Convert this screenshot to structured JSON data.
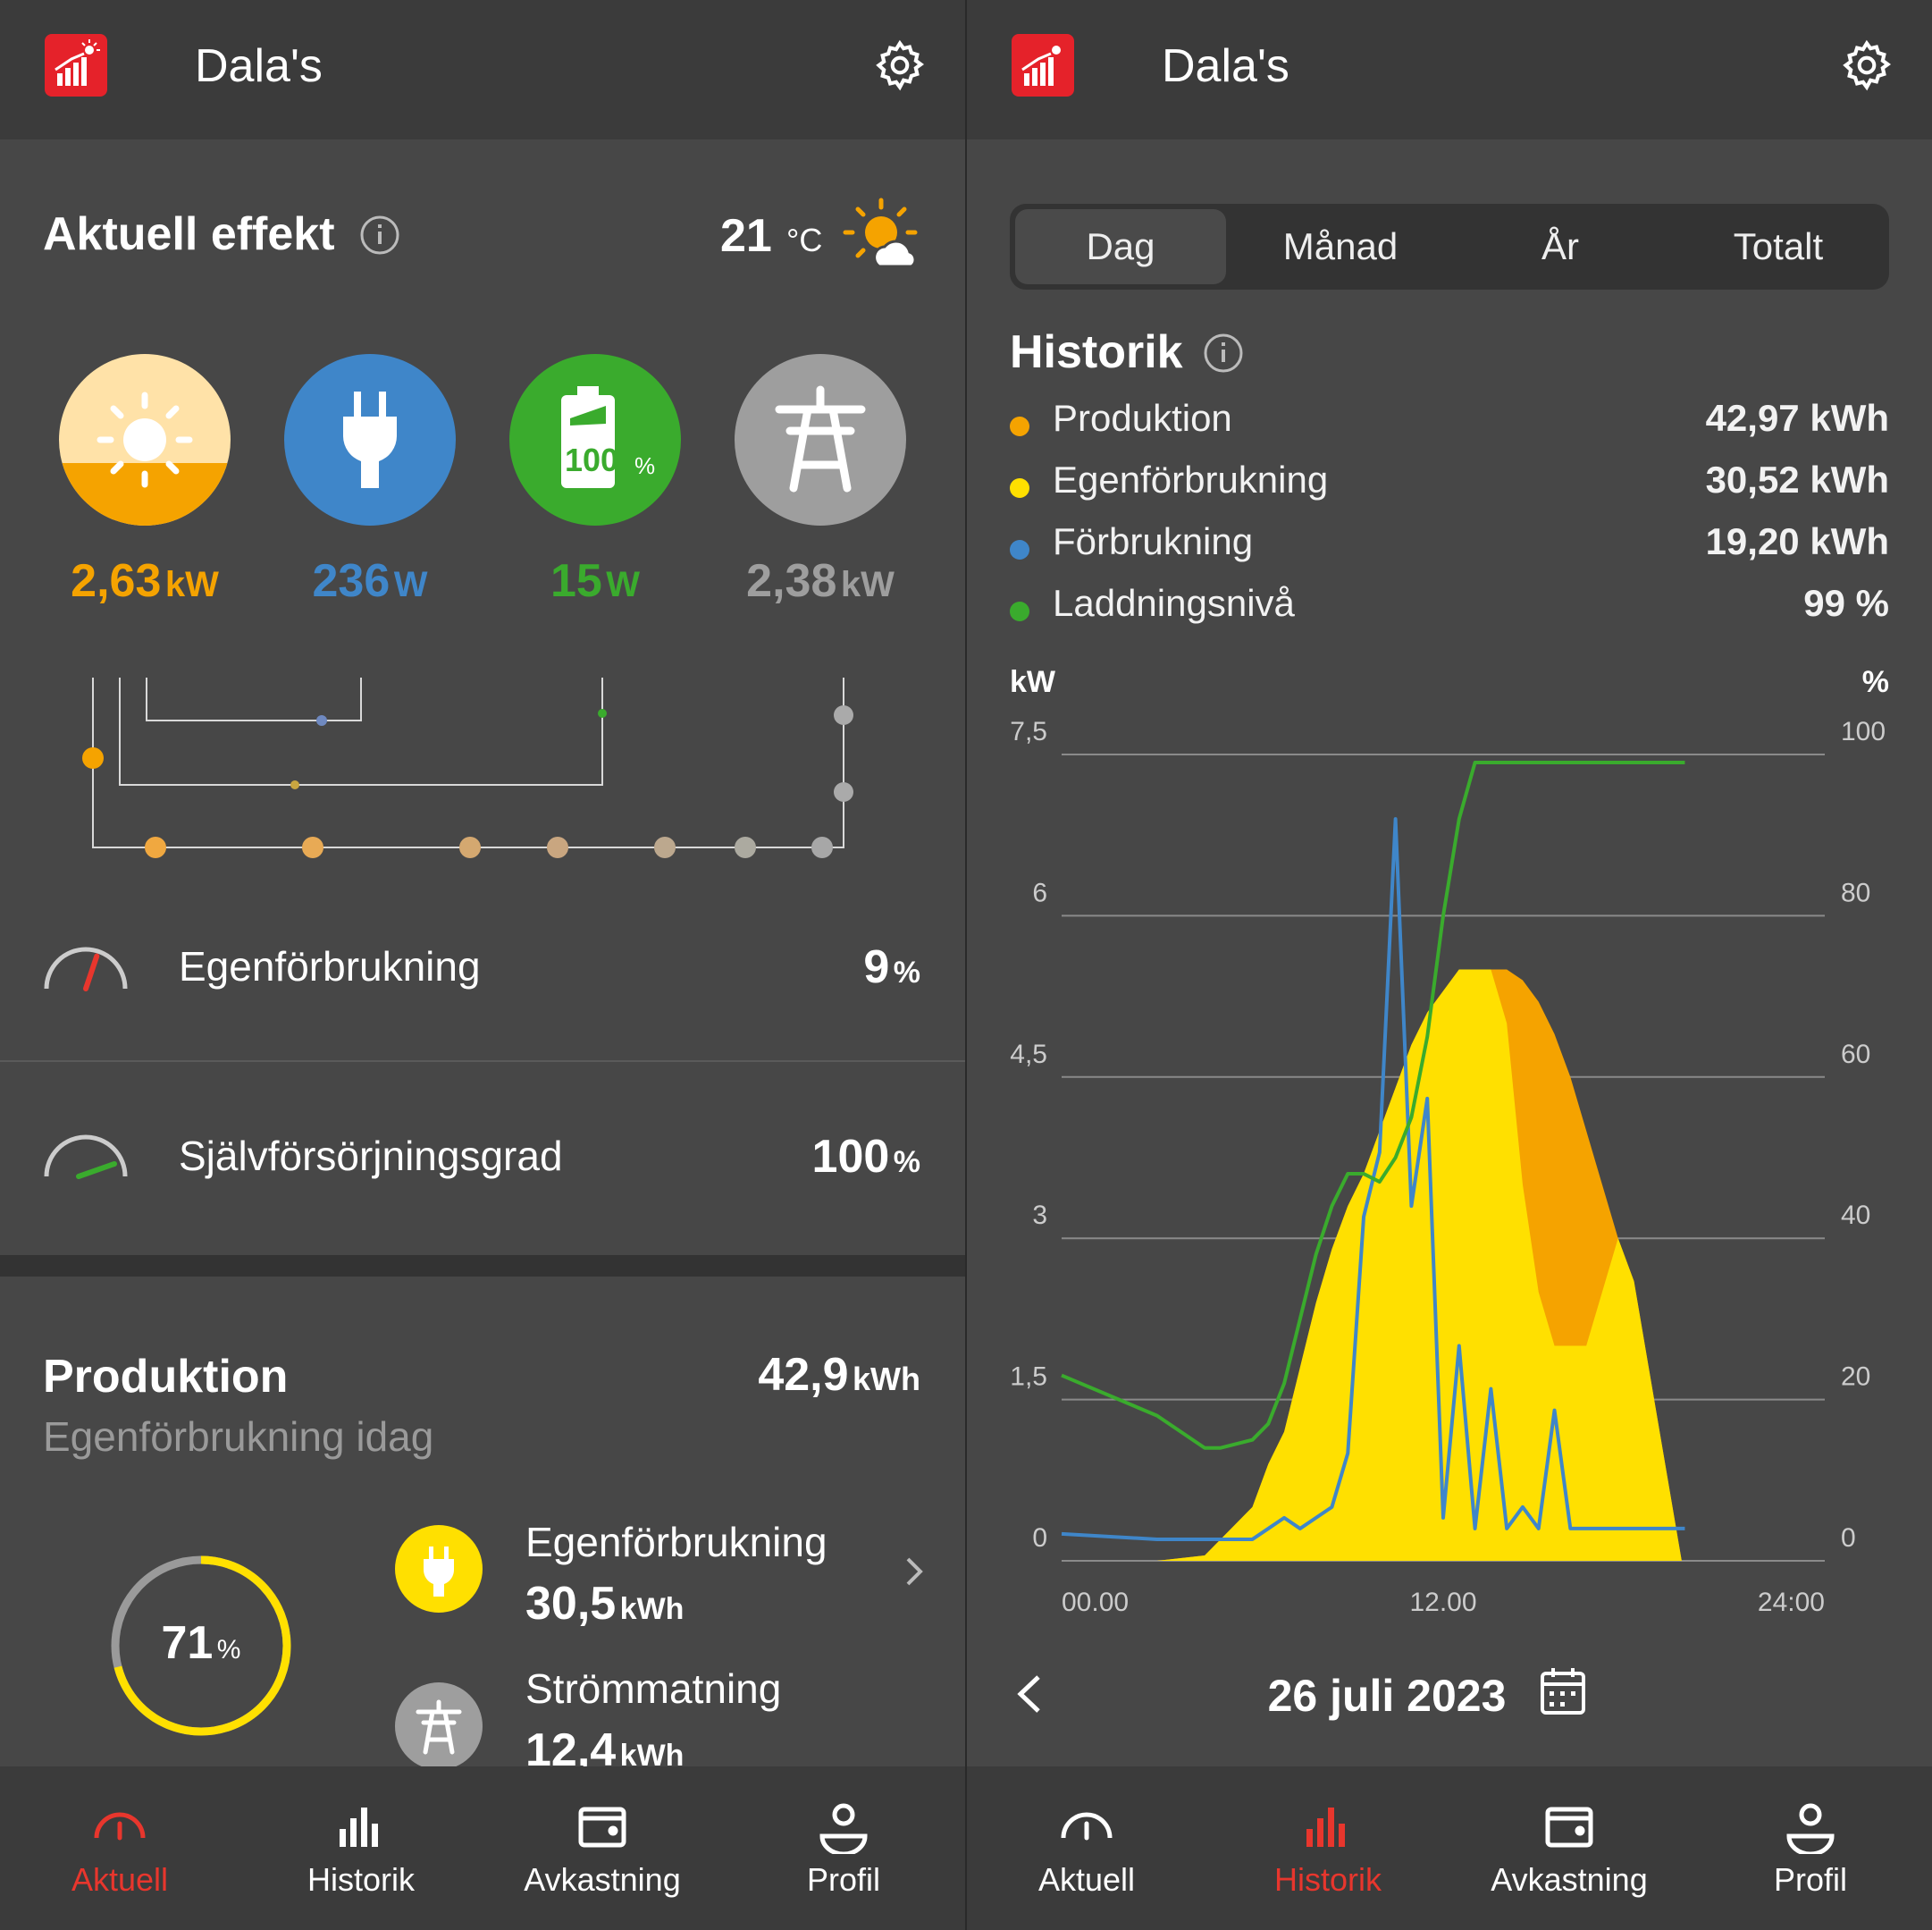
{
  "app_title": "Dala's",
  "left": {
    "section_title": "Aktuell effekt",
    "temperature": {
      "value": "21",
      "unit": "°C"
    },
    "flows": [
      {
        "name": "solar",
        "value": "2,63",
        "unit": "kW",
        "color": "#f5a300"
      },
      {
        "name": "consumption",
        "value": "236",
        "unit": "W",
        "color": "#3f86c9"
      },
      {
        "name": "battery",
        "value": "15",
        "unit": "W",
        "color": "#3aab2d",
        "battery_label": "100",
        "battery_unit": "%"
      },
      {
        "name": "grid",
        "value": "2,38",
        "unit": "kW",
        "color": "#9e9e9e"
      }
    ],
    "metrics": [
      {
        "label": "Egenförbrukning",
        "value": "9",
        "unit": "%"
      },
      {
        "label": "Självförsörjningsgrad",
        "value": "100",
        "unit": "%"
      }
    ],
    "production": {
      "title": "Produktion",
      "value": "42,9",
      "unit": "kWh",
      "subtitle": "Egenförbrukning idag",
      "ring_value": "71",
      "ring_unit": "%",
      "ring_fraction": 0.71,
      "items": [
        {
          "label": "Egenförbrukning",
          "value": "30,5",
          "unit": "kWh"
        },
        {
          "label": "Strömmatning",
          "value": "12,4",
          "unit": "kWh"
        }
      ]
    }
  },
  "right": {
    "tabs": [
      "Dag",
      "Månad",
      "År",
      "Totalt"
    ],
    "selected_tab": "Dag",
    "history_title": "Historik",
    "legend": [
      {
        "label": "Produktion",
        "value": "42,97 kWh",
        "color": "#f5a300"
      },
      {
        "label": "Egenförbrukning",
        "value": "30,52 kWh",
        "color": "#ffe000"
      },
      {
        "label": "Förbrukning",
        "value": "19,20 kWh",
        "color": "#3f86c9"
      },
      {
        "label": "Laddningsnivå",
        "value": "99 %",
        "color": "#3aab2d"
      }
    ],
    "date": "26 juli 2023"
  },
  "chart_data": {
    "type": "area",
    "xlabel": "",
    "ylabel": "kW",
    "y2label": "%",
    "x_ticks": [
      "00.00",
      "12.00",
      "24:00"
    ],
    "y_ticks": [
      "0",
      "1,5",
      "3",
      "4,5",
      "6",
      "7,5"
    ],
    "y2_ticks": [
      "0",
      "20",
      "40",
      "60",
      "80",
      "100"
    ],
    "ylim": [
      0,
      7.5
    ],
    "y2lim": [
      0,
      100
    ],
    "x_hours": [
      0,
      3,
      4.5,
      5,
      6,
      6.5,
      7,
      7.5,
      8,
      8.5,
      9,
      9.5,
      10,
      10.5,
      11,
      11.5,
      12,
      12.5,
      13,
      13.5,
      14,
      14.5,
      15,
      15.5,
      16,
      16.5,
      17,
      17.5,
      18,
      19.5,
      19.6
    ],
    "series": [
      {
        "name": "Produktion",
        "axis": "kW",
        "values": [
          0,
          0,
          0.05,
          0.2,
          0.5,
          0.9,
          1.2,
          1.8,
          2.4,
          2.9,
          3.3,
          3.6,
          4.0,
          4.4,
          4.8,
          5.1,
          5.3,
          5.5,
          5.5,
          5.5,
          5.5,
          5.4,
          5.2,
          4.9,
          4.5,
          4.0,
          3.5,
          3.0,
          2.6,
          0,
          0
        ]
      },
      {
        "name": "Egenförbrukning",
        "axis": "kW",
        "values": [
          0,
          0,
          0.05,
          0.2,
          0.5,
          0.9,
          1.2,
          1.8,
          2.4,
          2.9,
          3.3,
          3.6,
          4.0,
          4.4,
          4.8,
          5.1,
          5.3,
          5.5,
          5.5,
          5.5,
          5.0,
          3.5,
          2.5,
          2.0,
          2.0,
          2.0,
          2.5,
          3.0,
          2.6,
          0,
          0
        ]
      },
      {
        "name": "Förbrukning",
        "axis": "kW",
        "values": [
          0.25,
          0.2,
          0.2,
          0.2,
          0.2,
          0.3,
          0.4,
          0.3,
          0.4,
          0.5,
          1.0,
          3.2,
          3.8,
          6.9,
          3.3,
          4.3,
          0.4,
          2.0,
          0.3,
          1.6,
          0.3,
          0.5,
          0.3,
          1.4,
          0.3,
          0.3,
          0.3,
          0.3,
          0.3,
          0.3,
          0.3
        ]
      },
      {
        "name": "Laddningsnivå",
        "axis": "%",
        "values": [
          23,
          18,
          14,
          14,
          15,
          17,
          22,
          30,
          38,
          44,
          48,
          48,
          47,
          50,
          55,
          65,
          80,
          92,
          99,
          99,
          99,
          99,
          99,
          99,
          99,
          99,
          99,
          99,
          99,
          99,
          99
        ]
      }
    ]
  }
}
